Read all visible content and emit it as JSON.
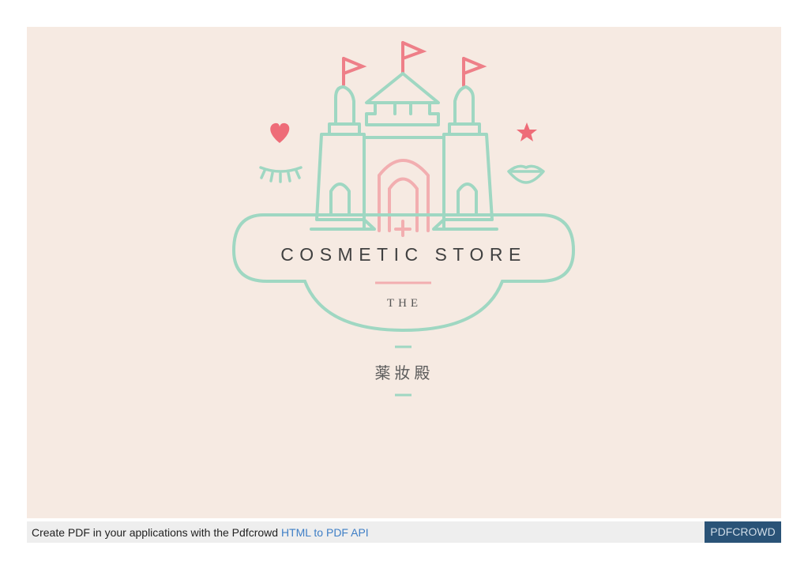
{
  "logo": {
    "main_text": "COSMETIC STORE",
    "small_text": "THE",
    "cjk_text": "薬妝殿",
    "colors": {
      "mint": "#9fd7c2",
      "pink": "#f2aeb0",
      "red": "#ee6c78",
      "text": "#404040",
      "background": "#f6eae2"
    }
  },
  "footer": {
    "prefix": "Create PDF in your applications with the Pdfcrowd ",
    "link_label": "HTML to PDF API",
    "badge_label": "PDFCROWD"
  }
}
